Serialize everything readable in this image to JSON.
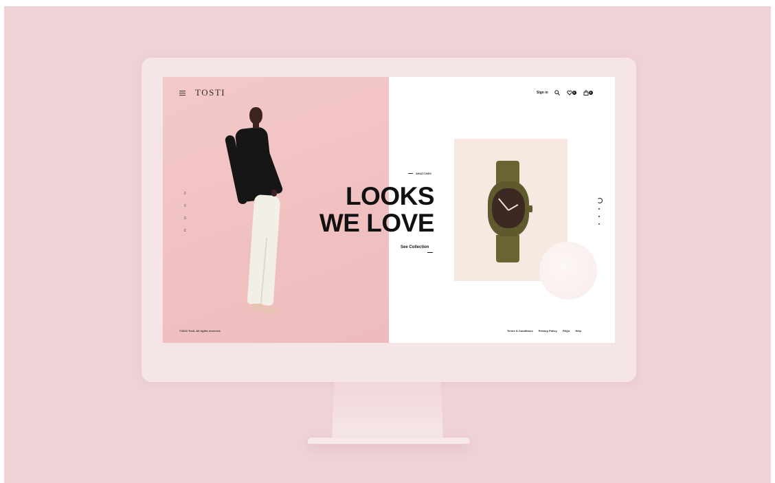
{
  "brand": {
    "logo": "TOSTI"
  },
  "nav": {
    "signin": "Sign in",
    "wishlist_count": "0",
    "cart_count": "0"
  },
  "pager": [
    "01",
    "02",
    "03",
    "04"
  ],
  "hero": {
    "category": "WHATCHES",
    "headline_line1": "LOOKS",
    "headline_line2": "WE LOVE",
    "cta": "See Collection"
  },
  "footer": {
    "copyright": "©2020 Tosti. All rights reserved.",
    "links": [
      "Terms & Conditions",
      "Privacy Policy",
      "FAQs",
      "Help"
    ]
  },
  "icons": [
    "menu-icon",
    "search-icon",
    "heart-icon",
    "bag-icon"
  ]
}
